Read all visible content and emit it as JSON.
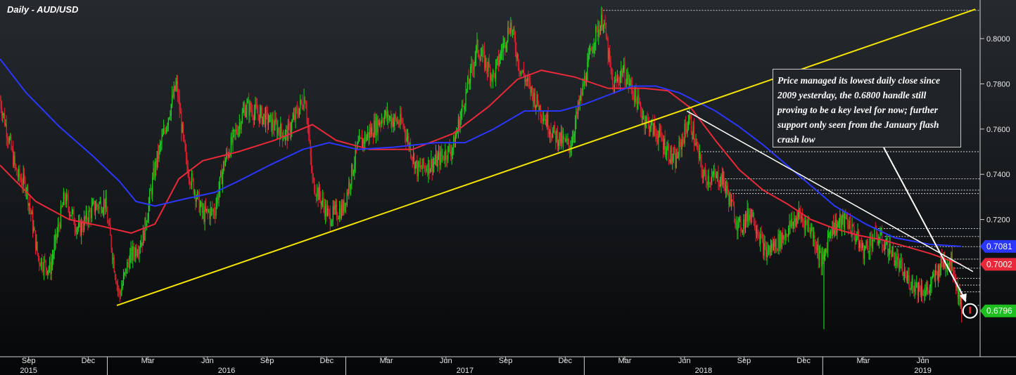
{
  "title": "Daily - AUD/USD",
  "annotation": "Price managed its lowest daily close since 2009 yesterday, the 0.6800 handle still proving to be a key level for now; further support only seen from the January flash crash low",
  "chart_data": {
    "type": "candlestick",
    "title": "Daily - AUD/USD",
    "ylim": [
      0.662,
      0.815
    ],
    "y_ticks": [
      "0.8000",
      "0.7800",
      "0.7600",
      "0.7400",
      "0.7200",
      "0.7000"
    ],
    "x_month_labels": [
      "Sep",
      "Dec",
      "Mar",
      "Jun",
      "Sep",
      "Dec",
      "Mar",
      "Jun",
      "Sep",
      "Dec",
      "Mar",
      "Jun",
      "Sep",
      "Dec",
      "Mar",
      "Jun"
    ],
    "x_year_labels": [
      "2015",
      "2016",
      "2017",
      "2018",
      "2019"
    ],
    "price_path": [
      [
        2015.55,
        0.773
      ],
      [
        2015.62,
        0.74
      ],
      [
        2015.66,
        0.735
      ],
      [
        2015.71,
        0.703
      ],
      [
        2015.76,
        0.698
      ],
      [
        2015.82,
        0.73
      ],
      [
        2015.88,
        0.715
      ],
      [
        2015.94,
        0.725
      ],
      [
        2015.99,
        0.728
      ],
      [
        2016.03,
        0.699
      ],
      [
        2016.05,
        0.686
      ],
      [
        2016.09,
        0.702
      ],
      [
        2016.15,
        0.712
      ],
      [
        2016.2,
        0.743
      ],
      [
        2016.29,
        0.78
      ],
      [
        2016.33,
        0.745
      ],
      [
        2016.4,
        0.722
      ],
      [
        2016.45,
        0.724
      ],
      [
        2016.49,
        0.745
      ],
      [
        2016.58,
        0.77
      ],
      [
        2016.66,
        0.765
      ],
      [
        2016.75,
        0.757
      ],
      [
        2016.83,
        0.775
      ],
      [
        2016.86,
        0.737
      ],
      [
        2016.93,
        0.721
      ],
      [
        2016.99,
        0.725
      ],
      [
        2017.05,
        0.752
      ],
      [
        2017.16,
        0.766
      ],
      [
        2017.24,
        0.762
      ],
      [
        2017.3,
        0.742
      ],
      [
        2017.37,
        0.745
      ],
      [
        2017.45,
        0.752
      ],
      [
        2017.55,
        0.796
      ],
      [
        2017.62,
        0.783
      ],
      [
        2017.69,
        0.807
      ],
      [
        2017.73,
        0.787
      ],
      [
        2017.8,
        0.772
      ],
      [
        2017.87,
        0.758
      ],
      [
        2017.94,
        0.752
      ],
      [
        2018.04,
        0.8
      ],
      [
        2018.08,
        0.809
      ],
      [
        2018.12,
        0.778
      ],
      [
        2018.16,
        0.786
      ],
      [
        2018.2,
        0.778
      ],
      [
        2018.25,
        0.765
      ],
      [
        2018.32,
        0.756
      ],
      [
        2018.38,
        0.745
      ],
      [
        2018.44,
        0.765
      ],
      [
        2018.5,
        0.739
      ],
      [
        2018.58,
        0.738
      ],
      [
        2018.65,
        0.716
      ],
      [
        2018.7,
        0.724
      ],
      [
        2018.76,
        0.705
      ],
      [
        2018.83,
        0.712
      ],
      [
        2018.9,
        0.722
      ],
      [
        2018.95,
        0.716
      ],
      [
        2019.0,
        0.7
      ],
      [
        2019.03,
        0.716
      ],
      [
        2019.1,
        0.72
      ],
      [
        2019.17,
        0.706
      ],
      [
        2019.22,
        0.713
      ],
      [
        2019.28,
        0.707
      ],
      [
        2019.35,
        0.694
      ],
      [
        2019.4,
        0.69
      ],
      [
        2019.44,
        0.688
      ],
      [
        2019.5,
        0.701
      ],
      [
        2019.54,
        0.702
      ],
      [
        2019.58,
        0.682
      ]
    ],
    "series": [
      {
        "color": "#e8293a",
        "values": [
          [
            2015.55,
            0.744
          ],
          [
            2015.7,
            0.728
          ],
          [
            2015.84,
            0.72
          ],
          [
            2015.98,
            0.717
          ],
          [
            2016.1,
            0.714
          ],
          [
            2016.2,
            0.718
          ],
          [
            2016.3,
            0.738
          ],
          [
            2016.4,
            0.746
          ],
          [
            2016.55,
            0.75
          ],
          [
            2016.7,
            0.755
          ],
          [
            2016.86,
            0.762
          ],
          [
            2016.96,
            0.755
          ],
          [
            2017.1,
            0.751
          ],
          [
            2017.28,
            0.751
          ],
          [
            2017.45,
            0.758
          ],
          [
            2017.6,
            0.77
          ],
          [
            2017.72,
            0.782
          ],
          [
            2017.82,
            0.786
          ],
          [
            2017.96,
            0.783
          ],
          [
            2018.1,
            0.778
          ],
          [
            2018.25,
            0.778
          ],
          [
            2018.35,
            0.777
          ],
          [
            2018.45,
            0.769
          ],
          [
            2018.55,
            0.755
          ],
          [
            2018.65,
            0.742
          ],
          [
            2018.75,
            0.733
          ],
          [
            2018.85,
            0.727
          ],
          [
            2018.95,
            0.72
          ],
          [
            2019.05,
            0.716
          ],
          [
            2019.15,
            0.713
          ],
          [
            2019.25,
            0.711
          ],
          [
            2019.35,
            0.708
          ],
          [
            2019.45,
            0.705
          ],
          [
            2019.58,
            0.7002
          ]
        ]
      },
      {
        "color": "#2b36ff",
        "values": [
          [
            2015.55,
            0.791
          ],
          [
            2015.66,
            0.776
          ],
          [
            2015.8,
            0.761
          ],
          [
            2015.94,
            0.748
          ],
          [
            2016.05,
            0.737
          ],
          [
            2016.12,
            0.728
          ],
          [
            2016.2,
            0.726
          ],
          [
            2016.32,
            0.729
          ],
          [
            2016.45,
            0.732
          ],
          [
            2016.55,
            0.737
          ],
          [
            2016.68,
            0.744
          ],
          [
            2016.82,
            0.751
          ],
          [
            2016.93,
            0.754
          ],
          [
            2017.05,
            0.751
          ],
          [
            2017.2,
            0.752
          ],
          [
            2017.38,
            0.754
          ],
          [
            2017.5,
            0.754
          ],
          [
            2017.62,
            0.76
          ],
          [
            2017.75,
            0.768
          ],
          [
            2017.9,
            0.768
          ],
          [
            2018.0,
            0.771
          ],
          [
            2018.1,
            0.775
          ],
          [
            2018.2,
            0.779
          ],
          [
            2018.3,
            0.779
          ],
          [
            2018.4,
            0.776
          ],
          [
            2018.55,
            0.768
          ],
          [
            2018.65,
            0.761
          ],
          [
            2018.75,
            0.753
          ],
          [
            2018.85,
            0.744
          ],
          [
            2018.95,
            0.735
          ],
          [
            2019.05,
            0.726
          ],
          [
            2019.18,
            0.718
          ],
          [
            2019.3,
            0.712
          ],
          [
            2019.45,
            0.709
          ],
          [
            2019.58,
            0.7081
          ]
        ]
      }
    ],
    "trendlines": [
      {
        "color": "#f5e400",
        "from": [
          2016.04,
          0.682
        ],
        "to": [
          2019.64,
          0.813
        ]
      },
      {
        "color": "#ffffff",
        "from": [
          2018.43,
          0.768
        ],
        "to": [
          2019.63,
          0.697
        ]
      }
    ],
    "support_levels": [
      0.8125,
      0.75,
      0.738,
      0.733,
      0.7315,
      0.716,
      0.7125,
      0.708,
      0.7025,
      0.7025,
      0.6985,
      0.694,
      0.691,
      0.688,
      0.682
    ],
    "price_tags": [
      {
        "label": "0.7081",
        "value": 0.7081,
        "color": "#2b36ff"
      },
      {
        "label": "0.7002",
        "value": 0.7002,
        "color": "#e8293a"
      },
      {
        "label": "0.6796",
        "value": 0.6796,
        "color": "#1fbe1f"
      }
    ]
  }
}
